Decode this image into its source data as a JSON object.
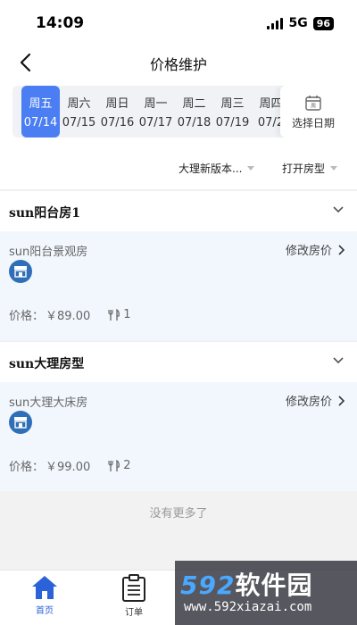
{
  "status_bar": {
    "time": "14:09",
    "network": "5G",
    "battery": "96"
  },
  "nav": {
    "title": "价格维护"
  },
  "dates": [
    {
      "weekday": "周五",
      "date": "07/14",
      "active": true
    },
    {
      "weekday": "周六",
      "date": "07/15"
    },
    {
      "weekday": "周日",
      "date": "07/16"
    },
    {
      "weekday": "周一",
      "date": "07/17"
    },
    {
      "weekday": "周二",
      "date": "07/18"
    },
    {
      "weekday": "周三",
      "date": "07/19"
    },
    {
      "weekday": "周四",
      "date": "07/2"
    }
  ],
  "date_picker": {
    "label": "选择日期",
    "icon_text": "周"
  },
  "filters": {
    "store": "大理新版本...",
    "room_type": "打开房型"
  },
  "groups": [
    {
      "title": "sun阳台房1",
      "room": {
        "name": "sun阳台景观房",
        "edit_label": "修改房价",
        "price_label": "价格：",
        "price": "￥89.00",
        "meals": "1"
      }
    },
    {
      "title": "sun大理房型",
      "room": {
        "name": "sun大理大床房",
        "edit_label": "修改房价",
        "price_label": "价格：",
        "price": "￥99.00",
        "meals": "2"
      }
    }
  ],
  "footer": {
    "no_more": "没有更多了"
  },
  "tabs": [
    {
      "label": "首页",
      "active": true
    },
    {
      "label": "订单"
    }
  ],
  "watermark": {
    "brand_num": "592",
    "brand_text": "软件园",
    "url": "www.592xiazai.com"
  },
  "colors": {
    "accent": "#4a7ef2",
    "tab_active": "#2b62d9",
    "card_bg": "#f1f7fd",
    "room_icon": "#2f6fb7"
  }
}
